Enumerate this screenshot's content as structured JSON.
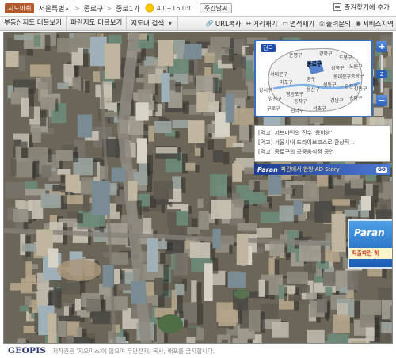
{
  "header": {
    "logo_tag": "지도이쉬",
    "breadcrumb": [
      "서울특별시",
      "종로구",
      "종로1가"
    ],
    "temperature": "4.0~16.0℃",
    "weekly_weather": "주간날씨",
    "favorite": "즐겨찾기에 추가"
  },
  "toolbar": {
    "left": [
      "부동산지도 더블보기",
      "파란지도 더블보기",
      "지도내 검색"
    ],
    "right": [
      "URL복사",
      "거리재기",
      "면적재기",
      "출력문의",
      "서비스지역"
    ]
  },
  "minimap": {
    "tag": "전국",
    "districts": [
      "은평구",
      "강북구",
      "도봉구",
      "노원구",
      "종로구",
      "성북구",
      "중랑구",
      "서대문구",
      "동대문구",
      "마포구",
      "중구",
      "성동구",
      "광진구",
      "강서구",
      "영등포구",
      "용산구",
      "양천구",
      "구로구",
      "동작구",
      "강남구",
      "송파구",
      "관악구",
      "서초구",
      "강동구"
    ],
    "highlight": "종로구"
  },
  "zoom": {
    "plus": "+",
    "minus": "−",
    "level": "2"
  },
  "news": [
    "[먹고] 서브마린의 진수 '동야항'",
    "[먹고] 서울시내 드라이브코스로 환상적 '.",
    "[먹고] 종로구의 공중음식점 공연"
  ],
  "paran": {
    "logo": "Paran",
    "slogan": "파란에서 한방 AD Story",
    "go": "GO"
  },
  "billboard": {
    "brand": "Paran",
    "strip": "직출파란 하"
  },
  "footer": {
    "brand": "GEOPIS",
    "copyright": "저작권은 '지오피스'에 있으며 무단전재, 복사, 배포를 금지합니다."
  },
  "colors": {
    "accent_blue": "#2a5fb8",
    "logo_tag": "#b35a2a",
    "footer_brand": "#2d3b6e"
  }
}
